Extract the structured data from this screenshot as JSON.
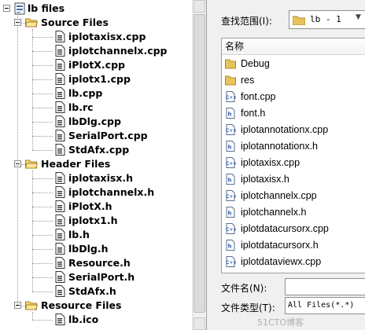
{
  "tree": {
    "root": "lb files",
    "groups": [
      {
        "name": "Source Files",
        "files": [
          "iplotaxisx.cpp",
          "iplotchannelx.cpp",
          "iPlotX.cpp",
          "iplotx1.cpp",
          "lb.cpp",
          "lb.rc",
          "lbDlg.cpp",
          "SerialPort.cpp",
          "StdAfx.cpp"
        ]
      },
      {
        "name": "Header Files",
        "files": [
          "iplotaxisx.h",
          "iplotchannelx.h",
          "iPlotX.h",
          "iplotx1.h",
          "lb.h",
          "lbDlg.h",
          "Resource.h",
          "SerialPort.h",
          "StdAfx.h"
        ]
      },
      {
        "name": "Resource Files",
        "files": [
          "lb.ico"
        ]
      }
    ]
  },
  "dialog": {
    "lookin_label": "查找范围(I):",
    "lookin_value": "lb - 1",
    "column_name": "名称",
    "items": [
      {
        "name": "Debug",
        "kind": "folder"
      },
      {
        "name": "res",
        "kind": "folder"
      },
      {
        "name": "font.cpp",
        "kind": "cpp"
      },
      {
        "name": "font.h",
        "kind": "h"
      },
      {
        "name": "iplotannotationx.cpp",
        "kind": "cpp"
      },
      {
        "name": "iplotannotationx.h",
        "kind": "h"
      },
      {
        "name": "iplotaxisx.cpp",
        "kind": "cpp"
      },
      {
        "name": "iplotaxisx.h",
        "kind": "h"
      },
      {
        "name": "iplotchannelx.cpp",
        "kind": "cpp"
      },
      {
        "name": "iplotchannelx.h",
        "kind": "h"
      },
      {
        "name": "iplotdatacursorx.cpp",
        "kind": "cpp"
      },
      {
        "name": "iplotdatacursorx.h",
        "kind": "h"
      },
      {
        "name": "iplotdataviewx.cpp",
        "kind": "cpp"
      }
    ],
    "filename_label": "文件名(N):",
    "filename_value": "",
    "filetype_label": "文件类型(T):",
    "filetype_value": "All Files(*.*)",
    "watermark": "51CTO博客"
  },
  "colors": {
    "folder": "#e8c35a",
    "selection": "#3399ff",
    "file_icon_blue": "#2f5ea8"
  }
}
